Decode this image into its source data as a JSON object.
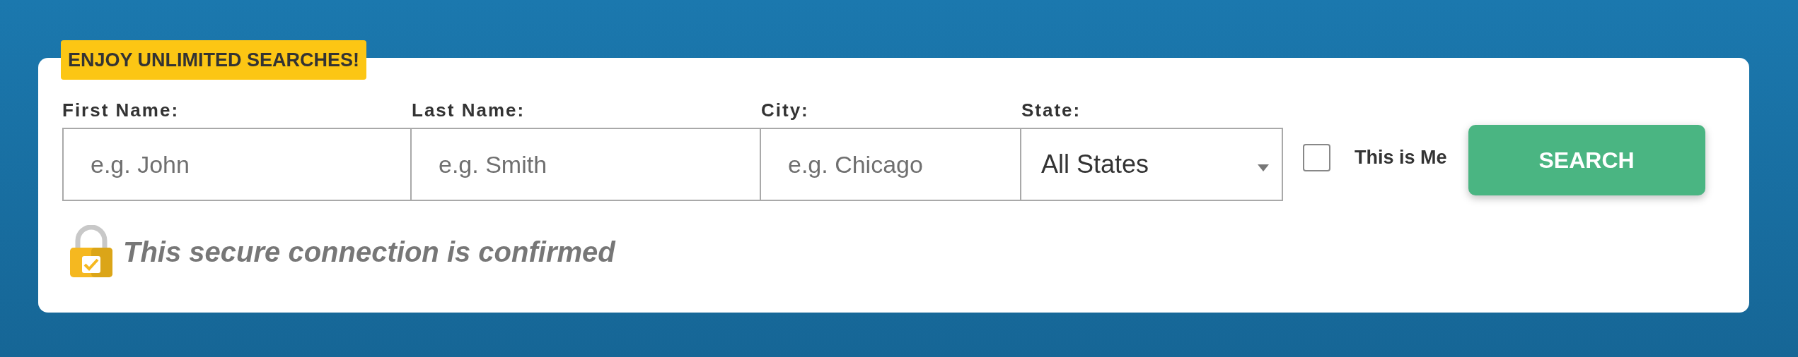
{
  "badge": "ENJOY UNLIMITED SEARCHES!",
  "fields": [
    {
      "kind": "text",
      "label": "First Name:",
      "placeholder": "e.g. John"
    },
    {
      "kind": "text",
      "label": "Last Name:",
      "placeholder": "e.g. Smith"
    },
    {
      "kind": "text",
      "label": "City:",
      "placeholder": "e.g. Chicago"
    },
    {
      "kind": "select",
      "label": "State:",
      "value": "All States"
    }
  ],
  "checkbox": {
    "label": "This is Me",
    "checked": false
  },
  "button": "SEARCH",
  "secure_note": "This secure connection is confirmed"
}
